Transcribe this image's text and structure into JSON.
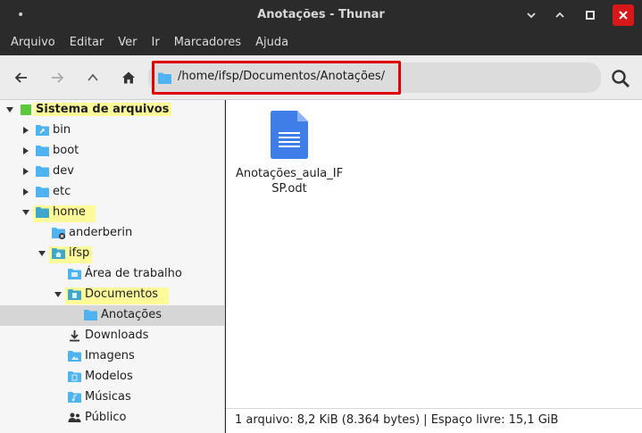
{
  "window": {
    "title": "Anotações - Thunar",
    "menu_dot": "•"
  },
  "menu": [
    "Arquivo",
    "Editar",
    "Ver",
    "Ir",
    "Marcadores",
    "Ajuda"
  ],
  "location": {
    "path": "/home/ifsp/Documentos/Anotações/"
  },
  "sidebar": {
    "root_label": "Sistema de arquivos",
    "items": [
      {
        "label": "bin",
        "icon": "folder-link-icon"
      },
      {
        "label": "boot",
        "icon": "folder-icon"
      },
      {
        "label": "dev",
        "icon": "folder-icon"
      },
      {
        "label": "etc",
        "icon": "folder-icon"
      },
      {
        "label": "home",
        "icon": "folder-open-icon"
      },
      {
        "label": "anderberin",
        "icon": "folder-locked-icon"
      },
      {
        "label": "ifsp",
        "icon": "home-folder-icon"
      },
      {
        "label": "Área de trabalho",
        "icon": "desktop-folder-icon"
      },
      {
        "label": "Documentos",
        "icon": "documents-folder-icon"
      },
      {
        "label": "Anotações",
        "icon": "folder-icon"
      },
      {
        "label": "Downloads",
        "icon": "download-icon"
      },
      {
        "label": "Imagens",
        "icon": "pictures-folder-icon"
      },
      {
        "label": "Modelos",
        "icon": "templates-folder-icon"
      },
      {
        "label": "Músicas",
        "icon": "music-folder-icon"
      },
      {
        "label": "Público",
        "icon": "public-folder-icon"
      }
    ]
  },
  "files": [
    {
      "name": "Anotações_aula_IFSP.odt",
      "name_line1": "Anotações_aula_IF",
      "name_line2": "SP.odt",
      "icon": "document-icon"
    }
  ],
  "status": {
    "text": "1 arquivo: 8,2 KiB (8.364 bytes)  |  Espaço livre: 15,1 GiB"
  },
  "colors": {
    "accent_folder": "#4fb3ef",
    "highlight": "#fdfa9a",
    "location_outline": "#e00000",
    "close_button": "#d81818"
  }
}
